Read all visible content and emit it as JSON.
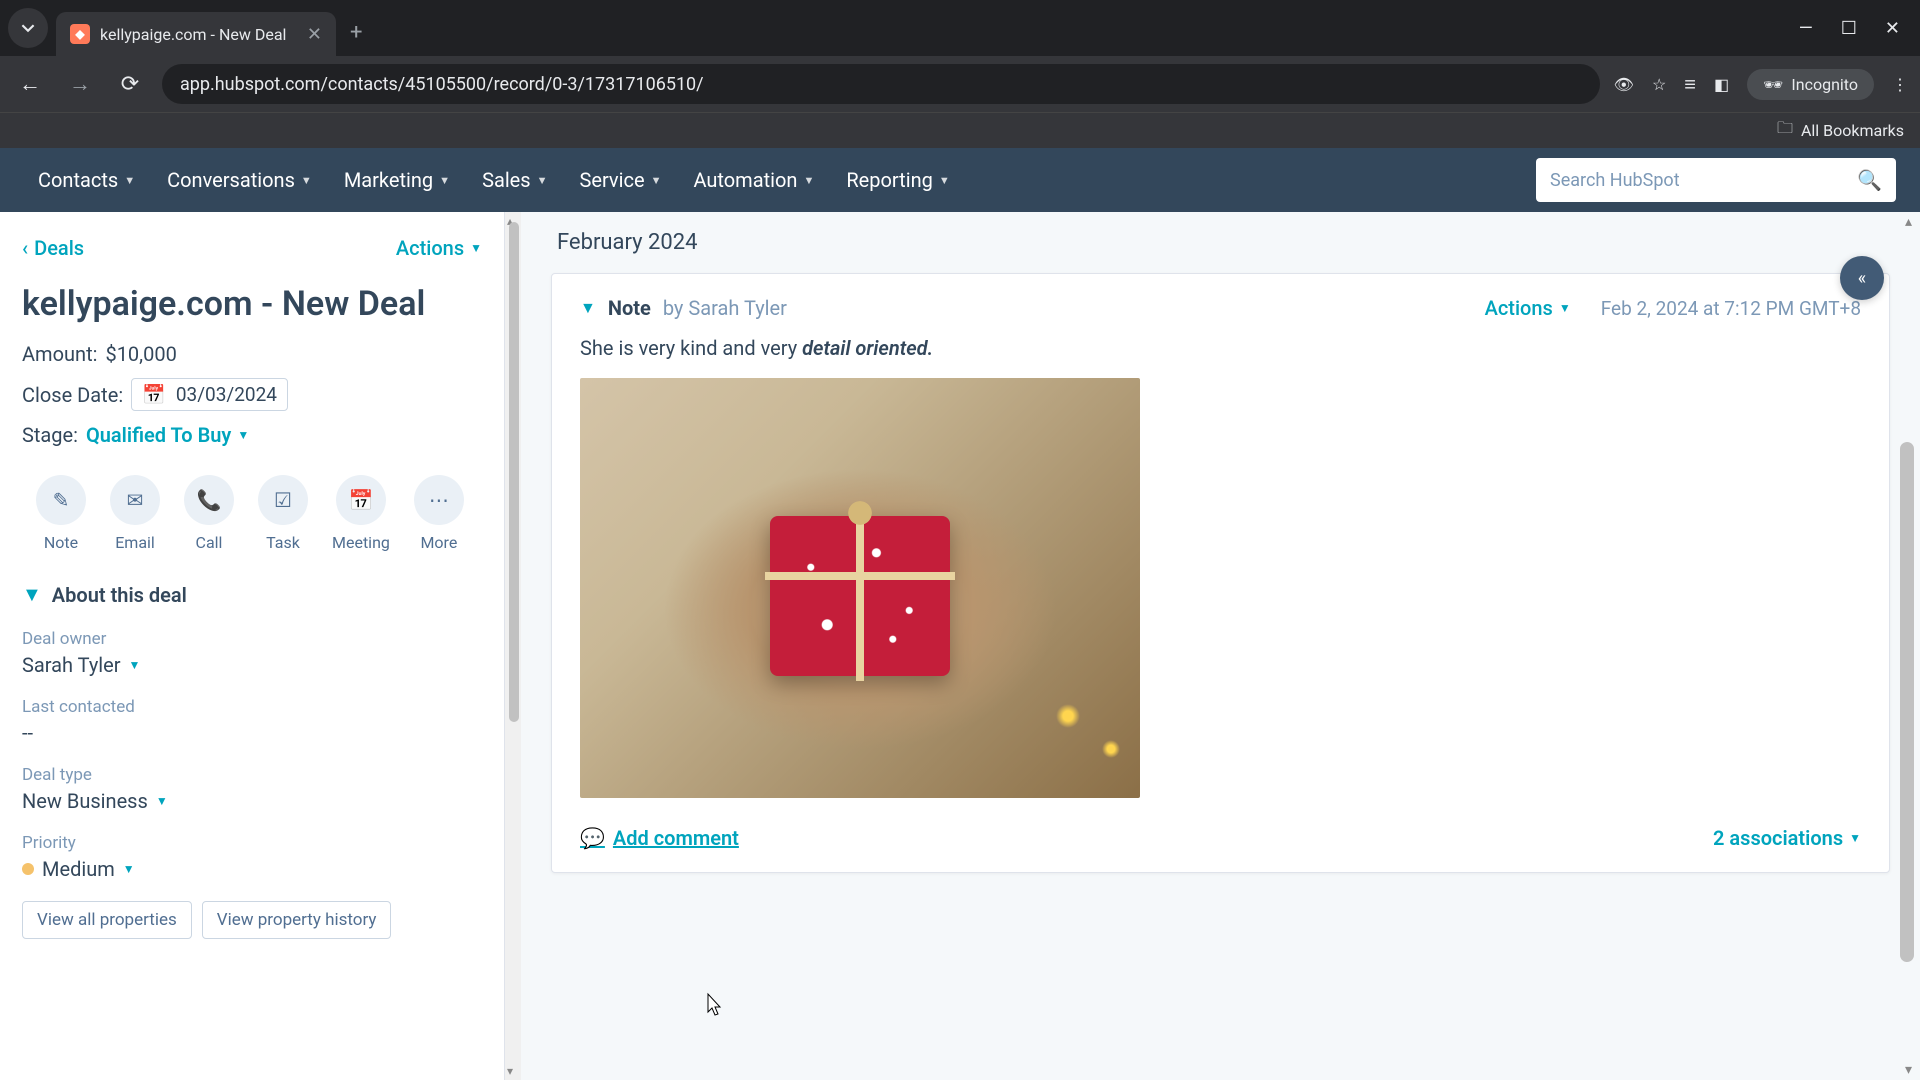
{
  "browser": {
    "tab_title": "kellypaige.com - New Deal",
    "url": "app.hubspot.com/contacts/45105500/record/0-3/17317106510/",
    "incognito": "Incognito",
    "all_bookmarks": "All Bookmarks"
  },
  "nav": {
    "items": [
      "Contacts",
      "Conversations",
      "Marketing",
      "Sales",
      "Service",
      "Automation",
      "Reporting"
    ],
    "search_placeholder": "Search HubSpot"
  },
  "sidebar": {
    "back": "Deals",
    "actions": "Actions",
    "title": "kellypaige.com - New Deal",
    "amount_label": "Amount:",
    "amount_value": "$10,000",
    "close_label": "Close Date:",
    "close_value": "03/03/2024",
    "stage_label": "Stage:",
    "stage_value": "Qualified To Buy",
    "action_buttons": [
      "Note",
      "Email",
      "Call",
      "Task",
      "Meeting",
      "More"
    ],
    "about_header": "About this deal",
    "props": {
      "owner_label": "Deal owner",
      "owner_value": "Sarah Tyler",
      "lastcontacted_label": "Last contacted",
      "lastcontacted_value": "--",
      "dealtype_label": "Deal type",
      "dealtype_value": "New Business",
      "priority_label": "Priority",
      "priority_value": "Medium"
    },
    "view_all": "View all properties",
    "view_history": "View property history"
  },
  "main": {
    "month": "February 2024",
    "note": {
      "label": "Note",
      "by_prefix": "by",
      "author": "Sarah Tyler",
      "actions": "Actions",
      "date": "Feb 2, 2024 at 7:12 PM GMT+8",
      "body_plain": "She is very kind and very ",
      "body_italic": "detail oriented.",
      "add_comment": "Add comment",
      "associations_count": "2 associations"
    }
  }
}
